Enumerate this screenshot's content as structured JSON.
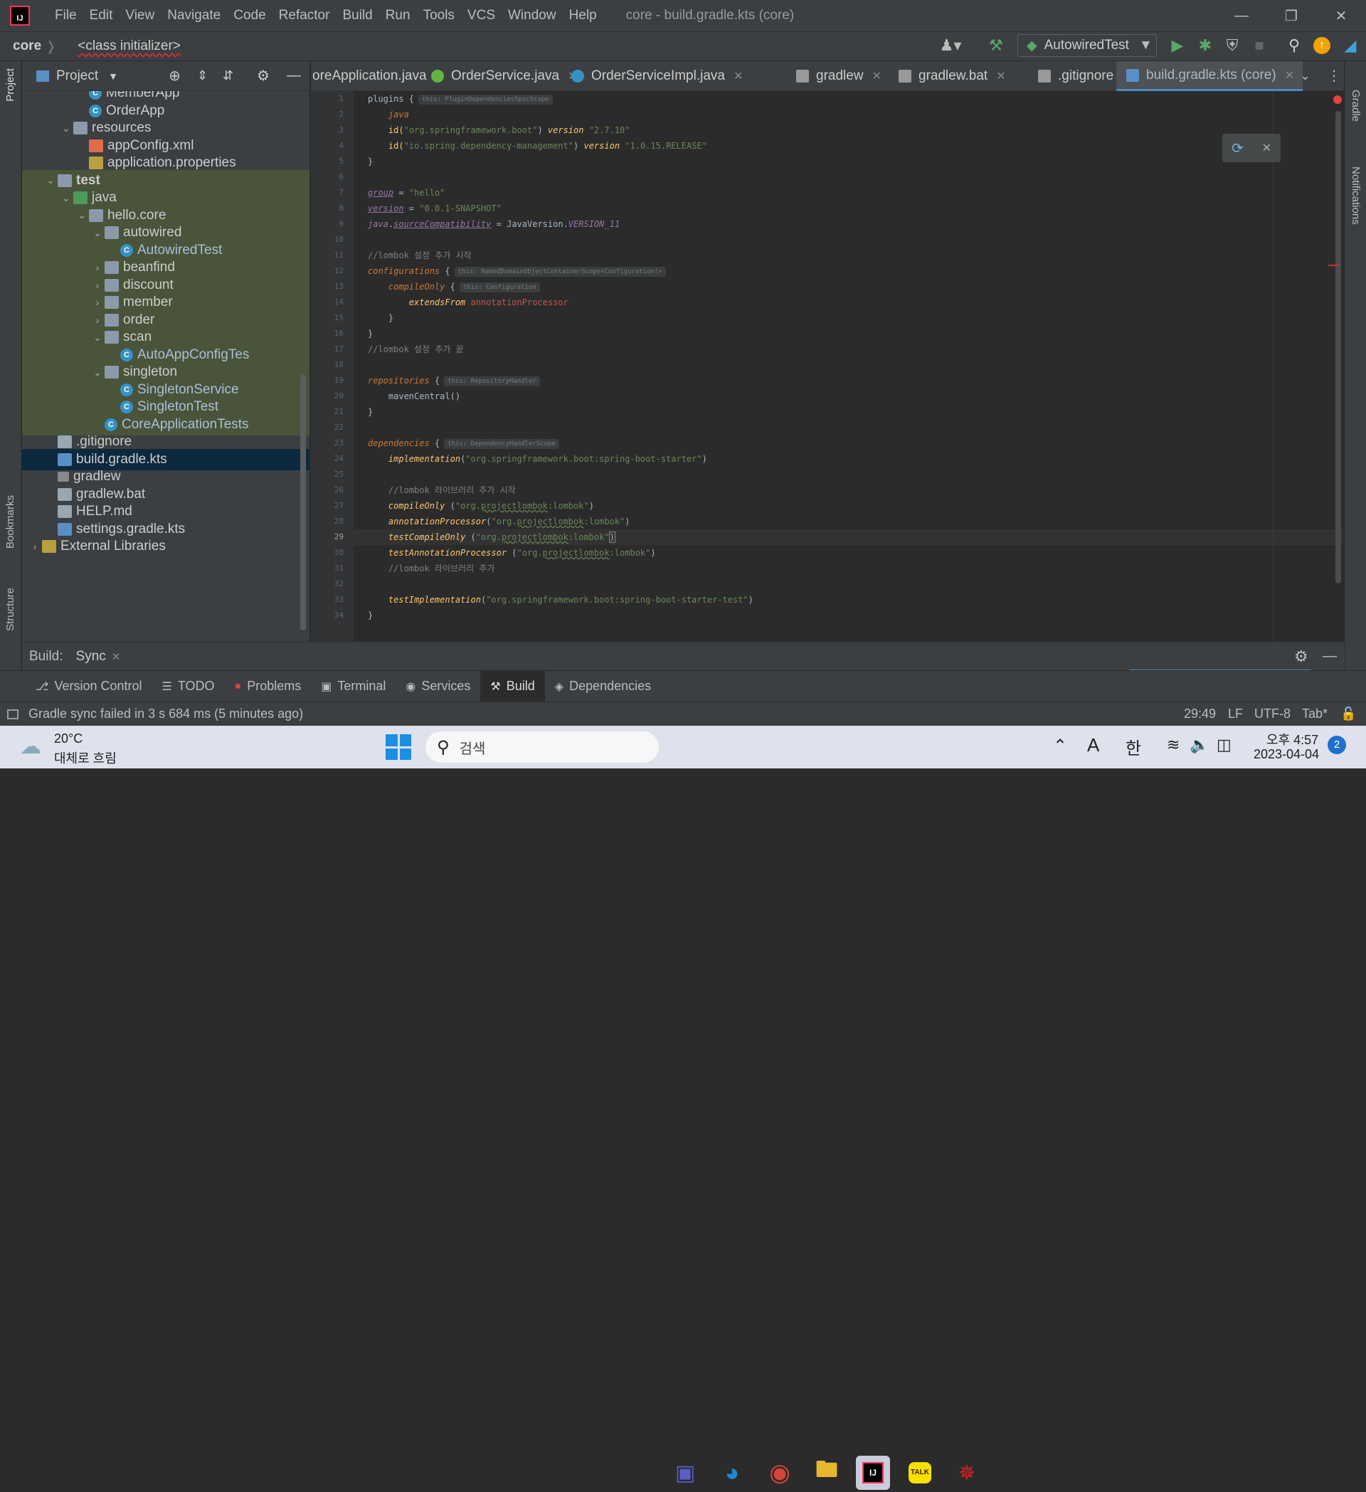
{
  "app": {
    "logo_text": "IJ",
    "window_title": "core - build.gradle.kts (core)",
    "menu": [
      "File",
      "Edit",
      "View",
      "Navigate",
      "Code",
      "Refactor",
      "Build",
      "Run",
      "Tools",
      "VCS",
      "Window",
      "Help"
    ]
  },
  "navbar": {
    "breadcrumb_project": "core",
    "breadcrumb_item": "<class initializer>",
    "run_config": "AutowiredTest"
  },
  "project_panel": {
    "title": "Project",
    "tree": [
      {
        "label": "MemberApp",
        "icon": "class-icon",
        "indent": 3
      },
      {
        "label": "OrderApp",
        "icon": "class-icon",
        "indent": 3
      },
      {
        "label": "resources",
        "icon": "folder-icon",
        "indent": 2,
        "arrow": "v"
      },
      {
        "label": "appConfig.xml",
        "icon": "xml-icon",
        "indent": 3
      },
      {
        "label": "application.properties",
        "icon": "properties-icon",
        "indent": 3
      },
      {
        "label": "test",
        "icon": "folder-icon",
        "indent": 1,
        "arrow": "v",
        "bold": true
      },
      {
        "label": "java",
        "icon": "source-folder-icon",
        "indent": 2,
        "arrow": "v"
      },
      {
        "label": "hello.core",
        "icon": "package-icon",
        "indent": 3,
        "arrow": "v"
      },
      {
        "label": "autowired",
        "icon": "package-icon",
        "indent": 4,
        "arrow": "v"
      },
      {
        "label": "AutowiredTest",
        "icon": "test-class-icon",
        "indent": 5
      },
      {
        "label": "beanfind",
        "icon": "package-icon",
        "indent": 4,
        "arrow": ">"
      },
      {
        "label": "discount",
        "icon": "package-icon",
        "indent": 4,
        "arrow": ">"
      },
      {
        "label": "member",
        "icon": "package-icon",
        "indent": 4,
        "arrow": ">"
      },
      {
        "label": "order",
        "icon": "package-icon",
        "indent": 4,
        "arrow": ">"
      },
      {
        "label": "scan",
        "icon": "package-icon",
        "indent": 4,
        "arrow": "v"
      },
      {
        "label": "AutoAppConfigTes",
        "icon": "test-class-icon",
        "indent": 5
      },
      {
        "label": "singleton",
        "icon": "package-icon",
        "indent": 4,
        "arrow": "v"
      },
      {
        "label": "SingletonService",
        "icon": "class-icon",
        "indent": 5
      },
      {
        "label": "SingletonTest",
        "icon": "class-icon",
        "indent": 5
      },
      {
        "label": "CoreApplicationTests",
        "icon": "test-class-icon",
        "indent": 4
      },
      {
        "label": ".gitignore",
        "icon": "gitignore-icon",
        "indent": 1
      },
      {
        "label": "build.gradle.kts",
        "icon": "gradle-kts-icon",
        "indent": 1,
        "selected": true
      },
      {
        "label": "gradlew",
        "icon": "terminal-file-icon",
        "indent": 1
      },
      {
        "label": "gradlew.bat",
        "icon": "file-icon",
        "indent": 1
      },
      {
        "label": "HELP.md",
        "icon": "file-icon",
        "indent": 1
      },
      {
        "label": "settings.gradle.kts",
        "icon": "gradle-kts-icon",
        "indent": 1
      },
      {
        "label": "External Libraries",
        "icon": "library-icon",
        "indent": 0,
        "arrow": ">"
      }
    ]
  },
  "tabs": [
    {
      "label": "oreApplication.java",
      "icon": "class-icon"
    },
    {
      "label": "OrderService.java",
      "icon": "interface-icon"
    },
    {
      "label": "OrderServiceImpl.java",
      "icon": "class-icon"
    },
    {
      "label": "gradlew",
      "icon": "terminal-file-icon"
    },
    {
      "label": "gradlew.bat",
      "icon": "file-icon"
    },
    {
      "label": ".gitignore",
      "icon": "gitignore-icon"
    },
    {
      "label": "build.gradle.kts (core)",
      "icon": "gradle-kts-icon",
      "active": true
    }
  ],
  "code": {
    "current_line": 29,
    "line_numbers": [
      "1",
      "2",
      "3",
      "4",
      "5",
      "6",
      "7",
      "8",
      "9",
      "10",
      "11",
      "12",
      "13",
      "14",
      "15",
      "16",
      "17",
      "18",
      "19",
      "20",
      "21",
      "22",
      "23",
      "24",
      "25",
      "26",
      "27",
      "28",
      "29",
      "30",
      "31",
      "32",
      "33",
      "34"
    ],
    "hints": {
      "plugins": "this: PluginDependenciesSpecScope",
      "configurations": "this: NamedDomainObjectContainerScope<Configuration!>",
      "compileOnly": "this: Configuration",
      "repositories": "this: RepositoryHandler",
      "dependencies": "this: DependencyHandlerScope"
    },
    "lines": {
      "l1": "plugins {",
      "l2_java": "java",
      "l3_a": "id(",
      "l3_b": "\"org.springframework.boot\"",
      "l3_c": ") ",
      "l3_d": "version",
      "l3_e": " \"2.7.10\"",
      "l4_a": "id(",
      "l4_b": "\"io.spring.dependency-management\"",
      "l4_c": ") ",
      "l4_d": "version",
      "l4_e": " \"1.0.15.RELEASE\"",
      "close": "}",
      "l7_a": "group",
      "l7_b": " = ",
      "l7_c": "\"hello\"",
      "l8_a": "version",
      "l8_b": " = ",
      "l8_c": "\"0.0.1-SNAPSHOT\"",
      "l9_a": "java",
      "l9_dot": ".",
      "l9_b": "sourceCompatibility",
      "l9_c": " = JavaVersion.",
      "l9_d": "VERSION_11",
      "l11": "//lombok 설정 추가 시작",
      "l12": "configurations",
      "l13": "compileOnly",
      "l14_a": "extendsFrom",
      "l14_b": " annotationProcessor",
      "l17": "//lombok 설정 추가 끝",
      "l19": "repositories",
      "l20": "mavenCentral()",
      "l23": "dependencies",
      "l24_a": "implementation",
      "l24_b": "(",
      "l24_c": "\"org.springframework.boot:spring-boot-starter\"",
      "l24_d": ")",
      "l26": "//lombok 라이브러리 추가 시작",
      "l27_a": "compileOnly",
      "l27_b": " (",
      "l28_a": "annotationProcessor",
      "l28_b": "(",
      "l29_a": "testCompileOnly",
      "l29_b": " (",
      "l30_a": "testAnnotationProcessor",
      "l30_b": " (",
      "lombok_pre": "\"org.",
      "lombok_mid": "projectlombok",
      "lombok_post": ":lombok\"",
      "rparen": ")",
      "l31": "//lombok 라이브러리 추가",
      "l33_a": "testImplementation",
      "l33_b": "(",
      "l33_c": "\"org.springframework.boot:spring-boot-starter-test\"",
      "l33_d": ")",
      "brace_open": " {"
    }
  },
  "build_bar": {
    "label": "Build:",
    "tab": "Sync"
  },
  "tool_windows": [
    {
      "label": "Version Control",
      "icon": "branch-icon"
    },
    {
      "label": "TODO",
      "icon": "list-icon"
    },
    {
      "label": "Problems",
      "icon": "error-icon"
    },
    {
      "label": "Terminal",
      "icon": "terminal-icon"
    },
    {
      "label": "Services",
      "icon": "services-icon"
    },
    {
      "label": "Build",
      "icon": "hammer-icon",
      "active": true
    },
    {
      "label": "Dependencies",
      "icon": "dependencies-icon"
    }
  ],
  "status": {
    "message": "Gradle sync failed in 3 s 684 ms (5 minutes ago)",
    "position": "29:49",
    "line_sep": "LF",
    "encoding": "UTF-8",
    "indent": "Tab*"
  },
  "side_labels": {
    "project": "Project",
    "bookmarks": "Bookmarks",
    "structure": "Structure",
    "gradle": "Gradle",
    "notifications": "Notifications"
  },
  "taskbar": {
    "weather_temp": "20°C",
    "weather_desc": "대체로 흐림",
    "search_placeholder": "검색",
    "ime_a": "A",
    "ime_lang": "한",
    "time": "오후 4:57",
    "date": "2023-04-04",
    "notif_count": "2",
    "talk_label": "TALK"
  },
  "colors": {
    "accent": "#4a88c7",
    "selection": "#0d293e",
    "test_bg": "#49543a",
    "error": "#e8413f",
    "run_green": "#59a869"
  }
}
